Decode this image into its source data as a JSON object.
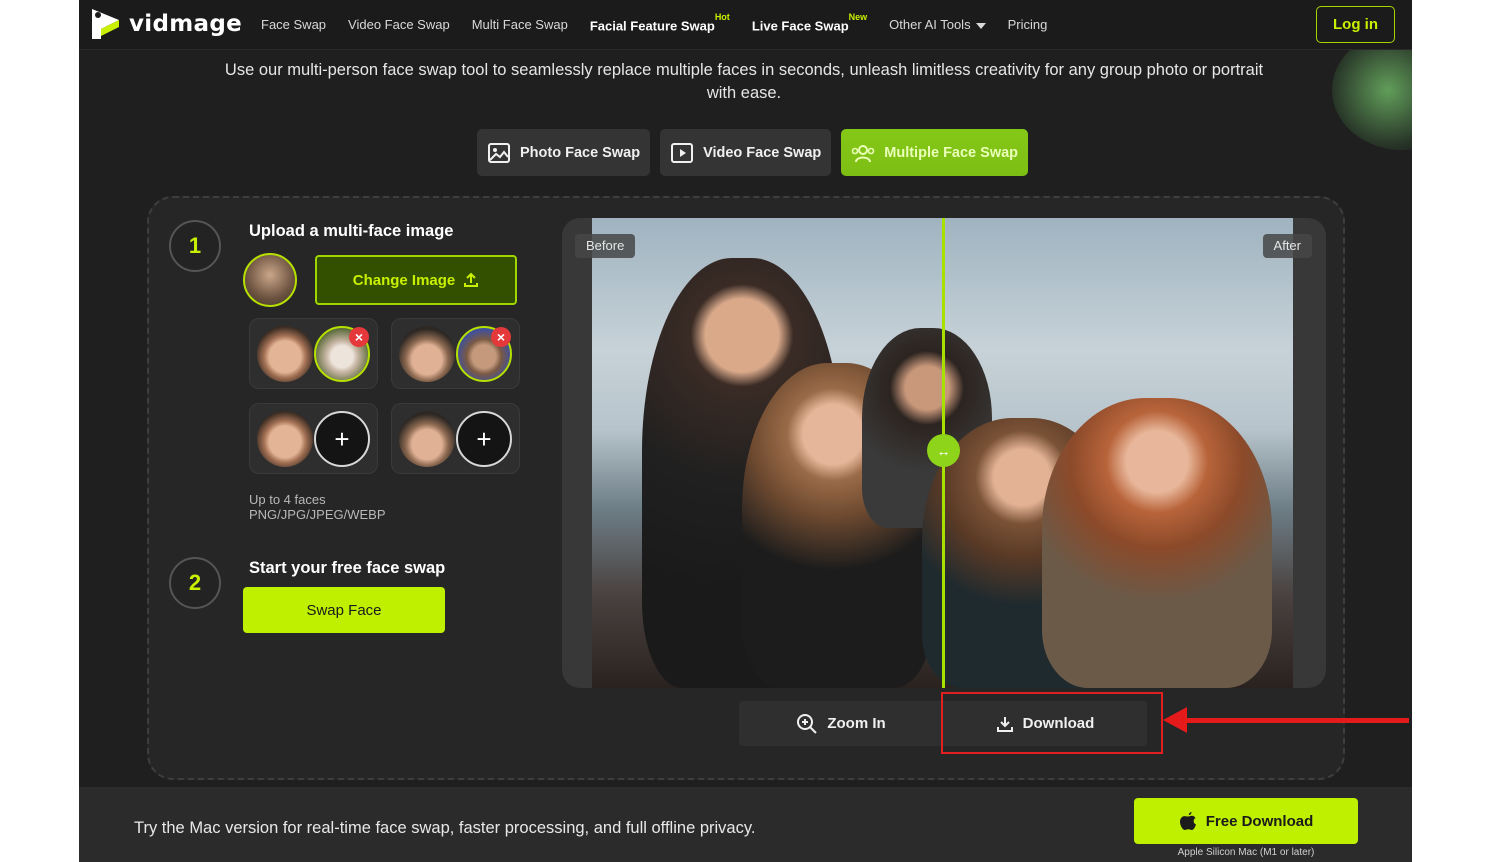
{
  "header": {
    "logo_text": "vidmage",
    "nav": [
      {
        "label": "Face Swap",
        "badge": ""
      },
      {
        "label": "Video Face Swap",
        "badge": ""
      },
      {
        "label": "Multi Face Swap",
        "badge": ""
      },
      {
        "label": "Facial Feature Swap",
        "badge": "Hot"
      },
      {
        "label": "Live Face Swap",
        "badge": "New"
      },
      {
        "label": "Other AI Tools",
        "badge": ""
      },
      {
        "label": "Pricing",
        "badge": ""
      }
    ],
    "login_label": "Log in"
  },
  "subtitle": "Use our multi-person face swap tool to seamlessly replace multiple faces in seconds, unleash limitless creativity for any group photo or portrait with ease.",
  "tabs": [
    {
      "label": "Photo Face Swap",
      "icon": "image-icon",
      "active": false
    },
    {
      "label": "Video Face Swap",
      "icon": "play-icon",
      "active": false
    },
    {
      "label": "Multiple Face Swap",
      "icon": "users-icon",
      "active": true
    }
  ],
  "step1": {
    "number": "1",
    "title": "Upload a multi-face image",
    "change_label": "Change Image",
    "hint": "Up to 4 faces PNG/JPG/JPEG/WEBP"
  },
  "step2": {
    "number": "2",
    "title": "Start your free face swap",
    "swap_label": "Swap Face"
  },
  "preview": {
    "before_label": "Before",
    "after_label": "After",
    "handle_glyph": "↔"
  },
  "actions": {
    "zoom_label": "Zoom In",
    "download_label": "Download"
  },
  "footer": {
    "text": "Try the Mac version for real-time face swap, faster processing, and full offline privacy.",
    "free_download_label": "Free Download",
    "note": "Apple Silicon Mac (M1 or later)"
  },
  "colors": {
    "accent": "#bff000",
    "background": "#1f1f1f",
    "annotation": "#e51a1a"
  }
}
